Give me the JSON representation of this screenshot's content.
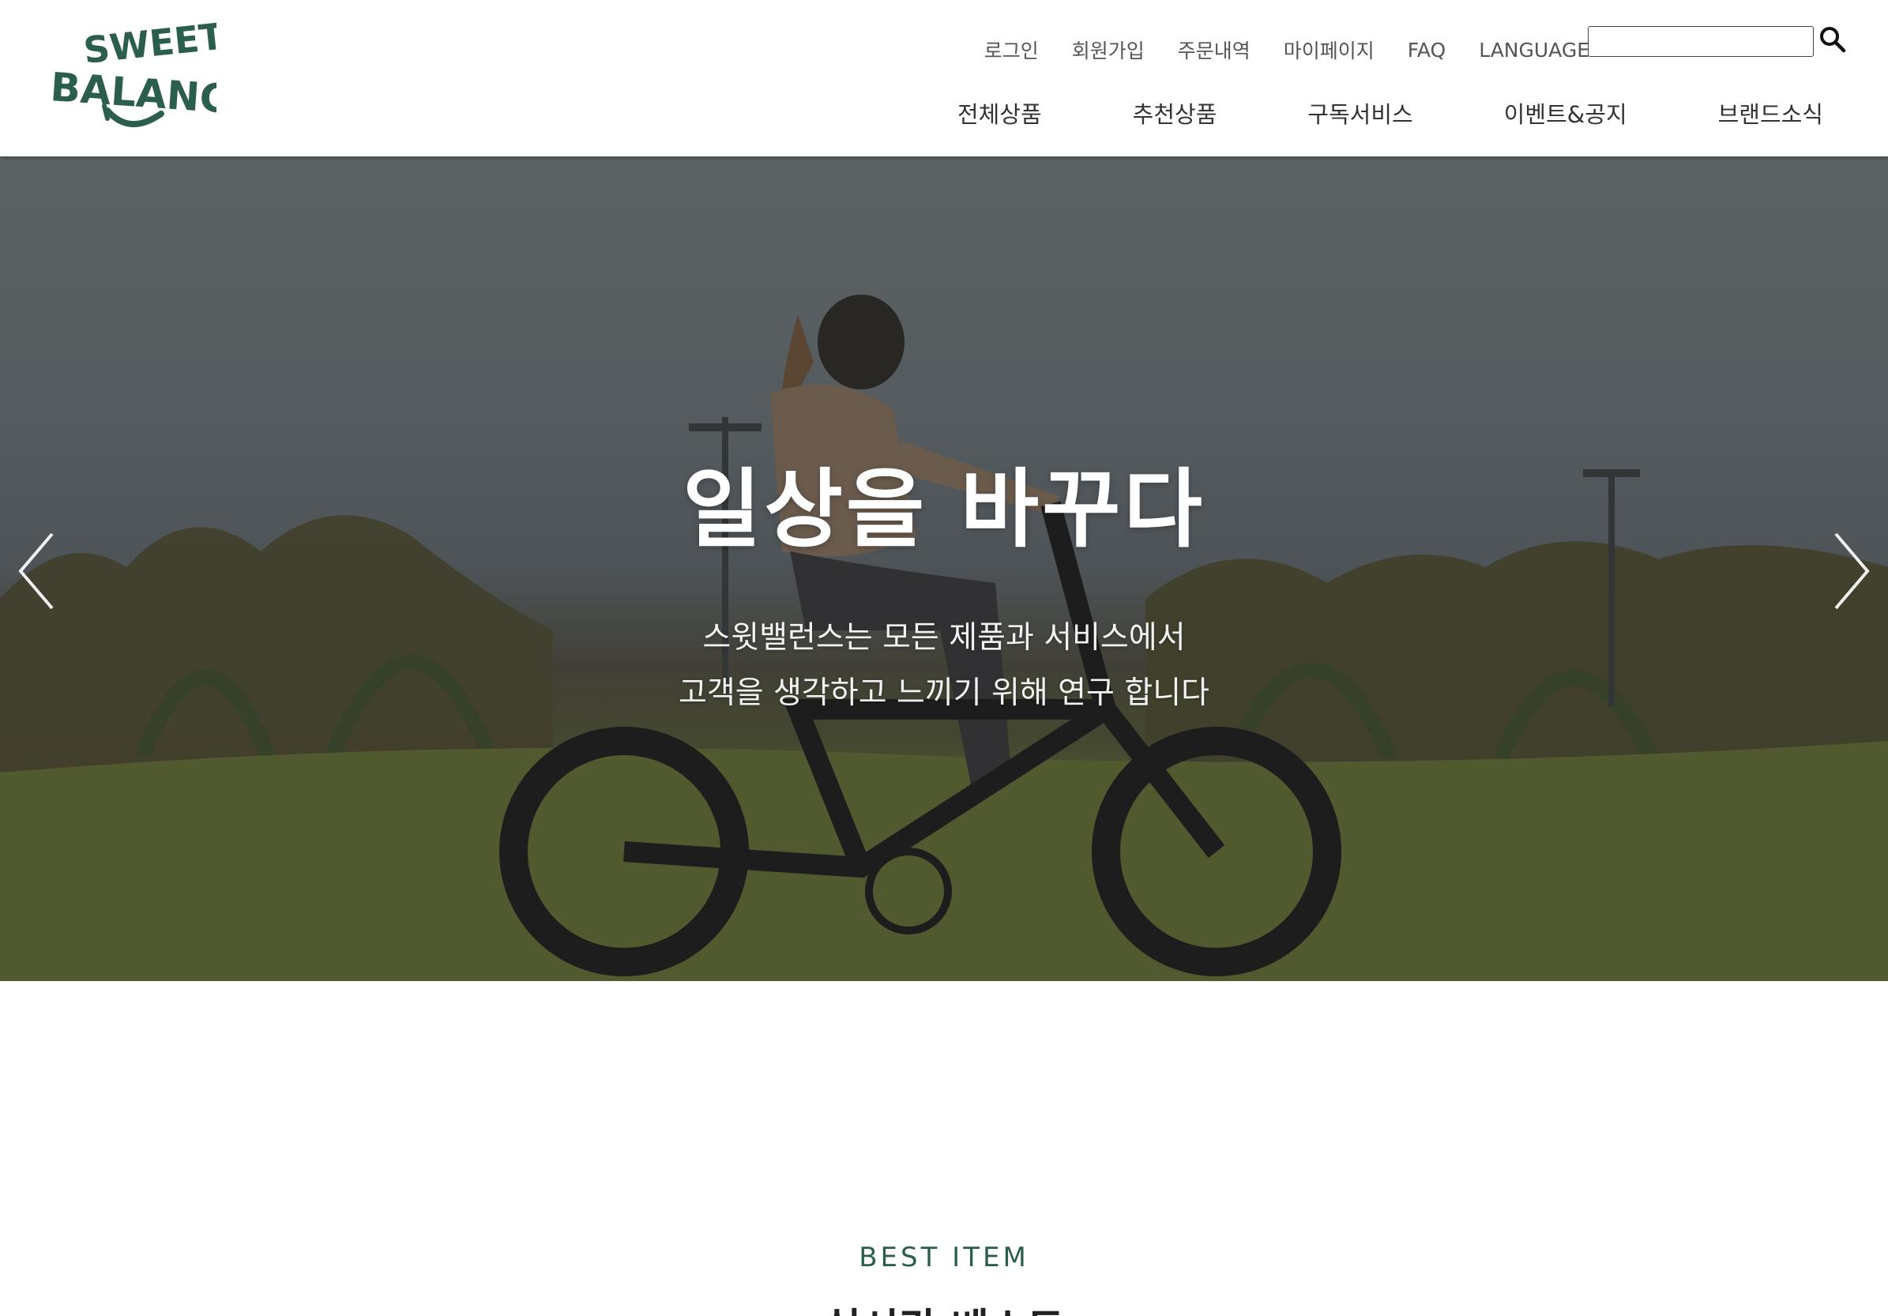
{
  "header": {
    "logo_alt": "SWEET BALANCE",
    "util_links": [
      "로그인",
      "회원가입",
      "주문내역",
      "마이페이지",
      "FAQ",
      "LANGUAGE"
    ],
    "search": {
      "value": "",
      "placeholder": ""
    },
    "main_nav": [
      "전체상품",
      "추천상품",
      "구독서비스",
      "이벤트&공지",
      "브랜드소식"
    ]
  },
  "hero": {
    "title": "일상을 바꾸다",
    "subtitle_line1": "스윗밸런스는 모든 제품과 서비스에서",
    "subtitle_line2": "고객을 생각하고 느끼기 위해 연구 합니다",
    "prev_icon": "chevron-left-icon",
    "next_icon": "chevron-right-icon"
  },
  "best": {
    "eyebrow": "BEST ITEM",
    "title": "실시간 베스트"
  },
  "colors": {
    "brand": "#2c5e4c",
    "hero_text": "#ffffff"
  }
}
